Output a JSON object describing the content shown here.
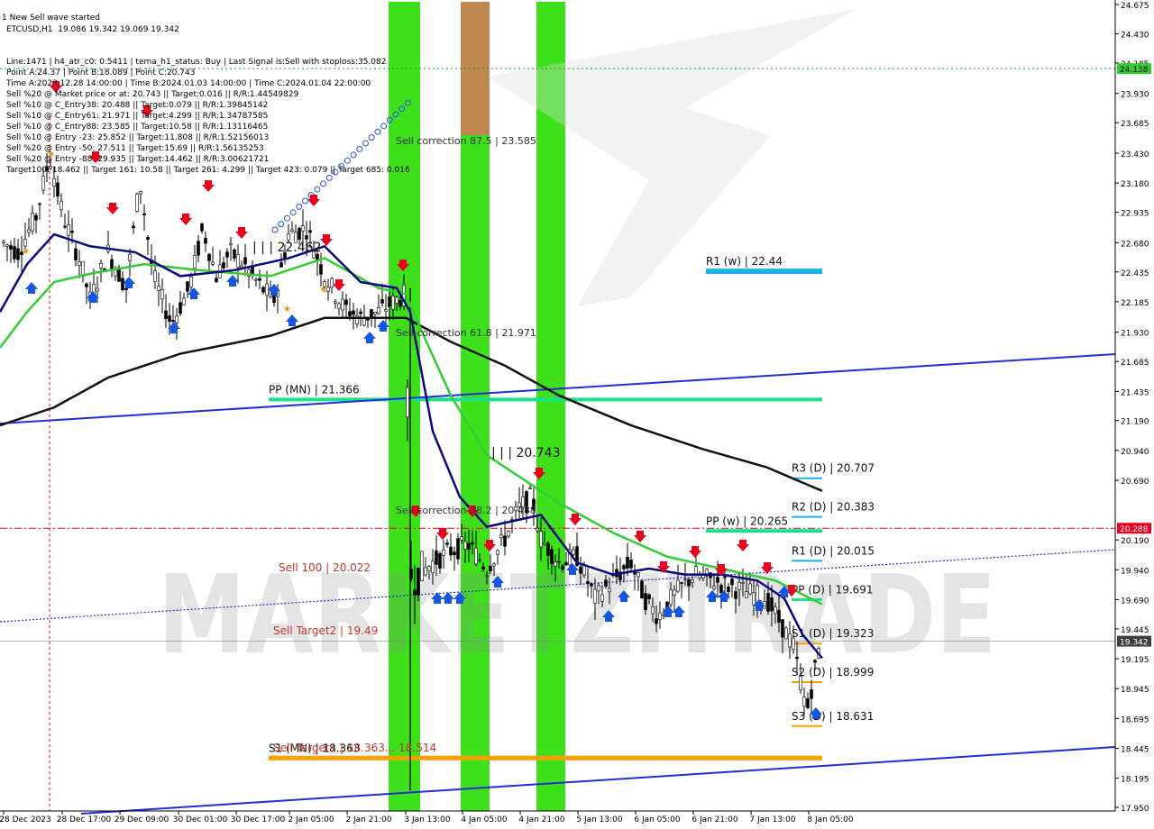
{
  "symbol_line": "ETCUSD,H1  19.086 19.342 19.069 19.342",
  "info_lines": [
    "Line:1471 | h4_atr_c0: 0.5411 | tema_h1_status: Buy | Last Signal is:Sell with stoploss:35.082",
    "Point A:24.37 | Point B:18.089 | Point C:20.743",
    "Time A:2023.12.28 14:00:00 | Time B:2024.01.03 14:00:00 | Time C:2024.01.04 22:00:00",
    "Sell %20 @ Market price or at: 20.743 || Target:0.016 || R/R:1.44549829",
    "Sell %10 @ C_Entry38: 20.488 || Target:0.079 || R/R:1.39845142",
    "Sell %10 @ C_Entry61: 21.971 || Target:4.299 || R/R:1.34787585",
    "Sell %10 @ C_Entry88: 23.585 || Target:10.58 || R/R:1.13116465",
    "Sell %10 @ Entry -23: 25.852 || Target:11.808 || R/R:1.52156013",
    "Sell %20 @ Entry -50: 27.511 || Target:15.69 || R/R:1.56135253",
    "Sell %20 @ Entry -88: 29.935 || Target:14.462 || R/R:3.00621721",
    "Target100: 18.462 || Target 161: 10.58 || Target 261: 4.299 || Target 423: 0.079 || Target 685: 0.016"
  ],
  "watermark": "MARKETZITRADE",
  "top_note": "1 New Sell wave started",
  "colors": {
    "bullish": "#000000",
    "bearish": "#000000",
    "ema_green": "#33cc33",
    "ema_navy": "#0a0a80",
    "sma_black": "#111111",
    "trend_blue": "#1f2fd1",
    "accent_red": "#e8001c",
    "price_tag": "#3d3d3d"
  },
  "chart_data": {
    "type": "candlestick",
    "title": "",
    "ylim": [
      17.95,
      24.675
    ],
    "y_ticks": [
      "24.675",
      "24.430",
      "24.185",
      "23.930",
      "23.685",
      "23.430",
      "23.180",
      "22.935",
      "22.680",
      "22.435",
      "22.185",
      "21.930",
      "21.685",
      "21.435",
      "21.190",
      "20.940",
      "20.690",
      "20.190",
      "19.940",
      "19.690",
      "19.445",
      "19.195",
      "18.945",
      "18.695",
      "18.445",
      "18.195",
      "17.950"
    ],
    "x_ticks": [
      "28 Dec 2023",
      "28 Dec 17:00",
      "29 Dec 09:00",
      "30 Dec 01:00",
      "30 Dec 17:00",
      "2 Jan 05:00",
      "2 Jan 21:00",
      "3 Jan 13:00",
      "4 Jan 05:00",
      "4 Jan 21:00",
      "5 Jan 13:00",
      "6 Jan 05:00",
      "6 Jan 21:00",
      "7 Jan 13:00",
      "8 Jan 05:00"
    ],
    "current_price": "19.342",
    "tag_top": "24.138",
    "tag_red": "20.288",
    "levels": [
      {
        "label": "R1 (w) | 22.44",
        "value": 22.44,
        "color": "#1eaee8"
      },
      {
        "label": "PP (MN) | 21.366",
        "value": 21.366,
        "color": "#19e08a"
      },
      {
        "label": "R3 (D) | 20.707",
        "value": 20.707,
        "color": "#1eaee8"
      },
      {
        "label": "R2 (D) | 20.383",
        "value": 20.383,
        "color": "#1eaee8"
      },
      {
        "label": "PP (w) | 20.265",
        "value": 20.265,
        "color": "#19e08a"
      },
      {
        "label": "R1 (D) | 20.015",
        "value": 20.015,
        "color": "#1eaee8"
      },
      {
        "label": "PP (D) | 19.691",
        "value": 19.691,
        "color": "#19e08a"
      },
      {
        "label": "S1 (D) | 19.323",
        "value": 19.323,
        "color": "#f5a000"
      },
      {
        "label": "S2 (D) | 18.999",
        "value": 18.999,
        "color": "#f5a000"
      },
      {
        "label": "S3 (D) | 18.631",
        "value": 18.631,
        "color": "#f5a000"
      },
      {
        "label": "S1 (MN) | 18.363",
        "value": 18.363,
        "color": "#f5a000"
      }
    ],
    "annotations": [
      {
        "text": "Sell correction 87.5 | 23.585"
      },
      {
        "text": "Sell correction 61.8 | 21.971"
      },
      {
        "text": "Sell correction 38.2 | 20.488"
      },
      {
        "text": "| | | 22.462"
      },
      {
        "text": "| | | 20.743"
      },
      {
        "text": "Sell 100 | 20.022"
      },
      {
        "text": "Sell Target2 | 19.49"
      },
      {
        "text": "Sell Target1 | 18.363... 18.514"
      }
    ]
  }
}
